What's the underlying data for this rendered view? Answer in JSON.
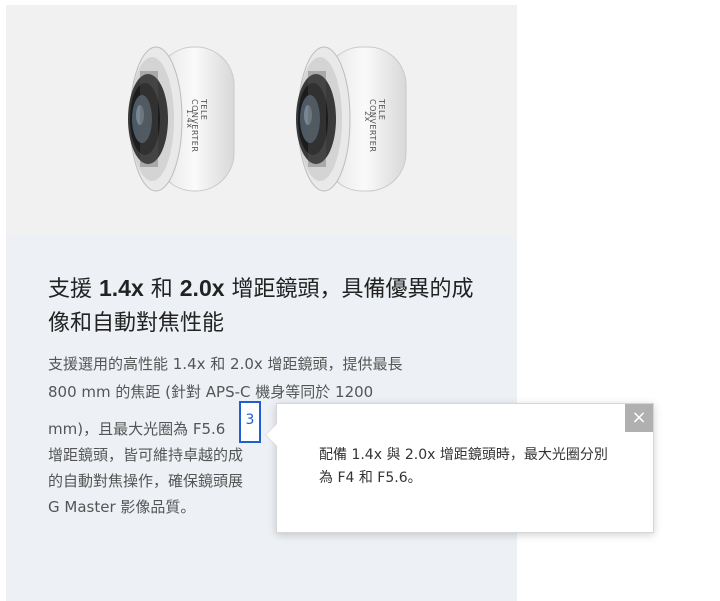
{
  "heading": {
    "part1": "支援 ",
    "bold1": "1.4x",
    "part2": " 和 ",
    "bold2": "2.0x",
    "part3": " 增距鏡頭，具備優異的成像和自動對焦性能"
  },
  "body": {
    "line1": "支援選用的高性能 1.4x 和 2.0x 增距鏡頭，提供最長",
    "line2": "800 mm 的焦距 (針對 APS-C 機身等同於 1200",
    "line3": "mm)，且最大光圈為 F5.6",
    "line4": "增距鏡頭，皆可維持卓越的成",
    "line5": "的自動對焦操作，確保鏡頭展",
    "line6": "G Master 影像品質。"
  },
  "footnote": {
    "number": "3"
  },
  "popup": {
    "close_label": "×",
    "text": "配備 1.4x 與 2.0x 增距鏡頭時，最大光圈分別為 F4 和 F5.6。"
  },
  "lenses": [
    {
      "marking": "1.4x",
      "brand": "TELE CONVERTER"
    },
    {
      "marking": "2x",
      "brand": "TELE CONVERTER"
    }
  ]
}
